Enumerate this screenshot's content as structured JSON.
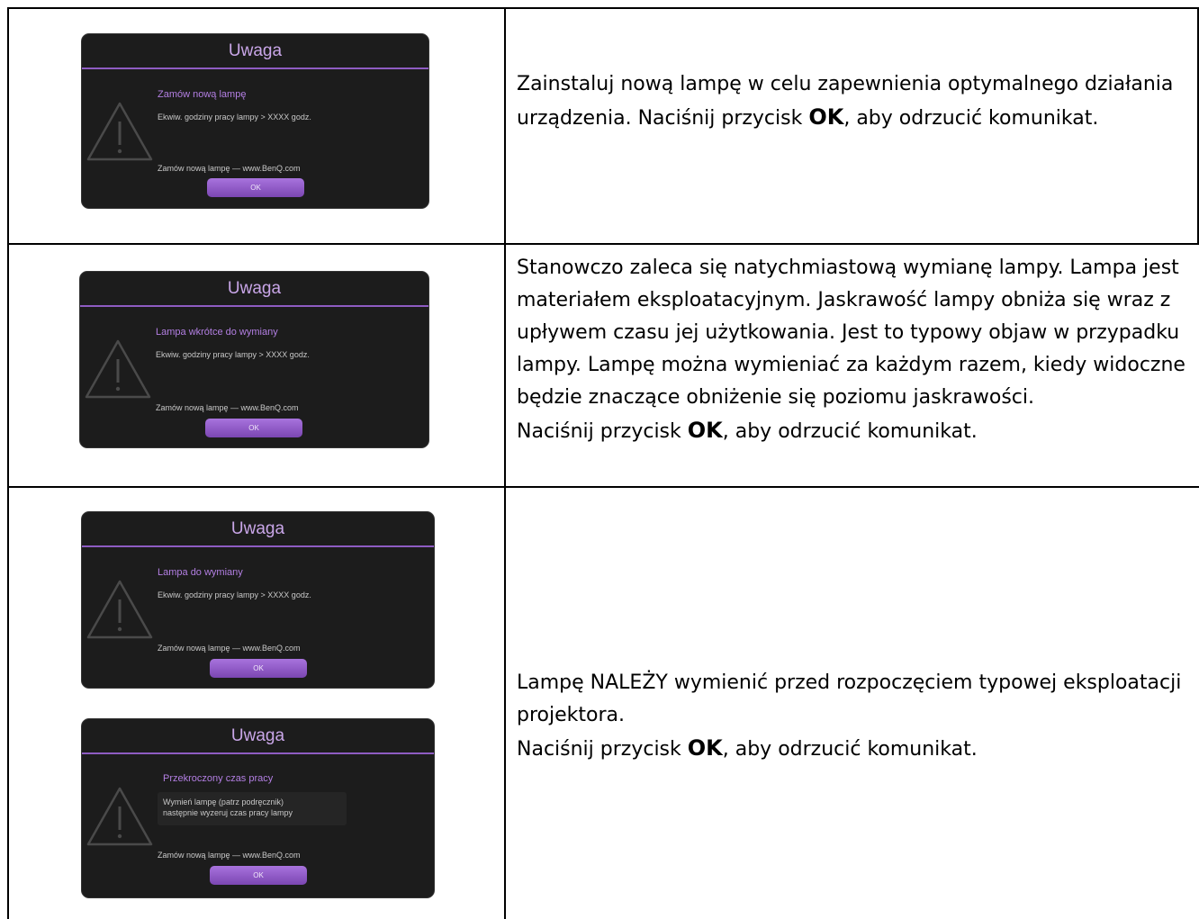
{
  "rows": [
    {
      "dialogs": [
        {
          "title": "Uwaga",
          "heading": "Zamów nową lampę",
          "line": "Ekwiw. godziny pracy lampy > XXXX godz.",
          "footer": "Zamów nową lampę — www.BenQ.com",
          "ok_label": "OK"
        }
      ],
      "description": {
        "text_before": "Zainstaluj nową lampę w celu zapewnienia optymalnego działania urządzenia. Naciśnij przycisk ",
        "ok": "OK",
        "text_after": ", aby odrzucić komunikat."
      }
    },
    {
      "dialogs": [
        {
          "title": "Uwaga",
          "heading": "Lampa wkrótce do wymiany",
          "line": "Ekwiw. godziny pracy lampy > XXXX godz.",
          "footer": "Zamów nową lampę — www.BenQ.com",
          "ok_label": "OK"
        }
      ],
      "description": {
        "paragraph": "Stanowczo zaleca się natychmiastową wymianę lampy. Lampa jest materiałem eksploatacyjnym. Jaskrawość lampy obniża się wraz z upływem czasu jej użytkowania. Jest to typowy objaw w przypadku lampy. Lampę można wymieniać za każdym razem, kiedy widoczne będzie znaczące obniżenie się poziomu jaskrawości.",
        "text_before": "Naciśnij przycisk ",
        "ok": "OK",
        "text_after": ", aby odrzucić komunikat."
      }
    },
    {
      "dialogs": [
        {
          "title": "Uwaga",
          "heading": "Lampa do wymiany",
          "line": "Ekwiw. godziny pracy lampy > XXXX godz.",
          "footer": "Zamów nową lampę — www.BenQ.com",
          "ok_label": "OK"
        },
        {
          "title": "Uwaga",
          "heading": "Przekroczony czas pracy",
          "line1": "Wymień lampę (patrz podręcznik)",
          "line2": "następnie wyzeruj czas pracy lampy",
          "footer": "Zamów nową lampę — www.BenQ.com",
          "ok_label": "OK"
        }
      ],
      "description": {
        "paragraph": "Lampę NALEŻY wymienić przed rozpoczęciem typowej eksploatacji projektora.",
        "text_before": "Naciśnij przycisk ",
        "ok": "OK",
        "text_after": ", aby odrzucić komunikat."
      }
    }
  ],
  "colors": {
    "dialog_background": "#1c1c1c",
    "dialog_title": "#c9a6e8",
    "dialog_rule": "#8e5cc2",
    "dialog_heading": "#b37fe3",
    "ok_button": "#9a63d0"
  },
  "icons": [
    "warning-triangle-icon"
  ]
}
